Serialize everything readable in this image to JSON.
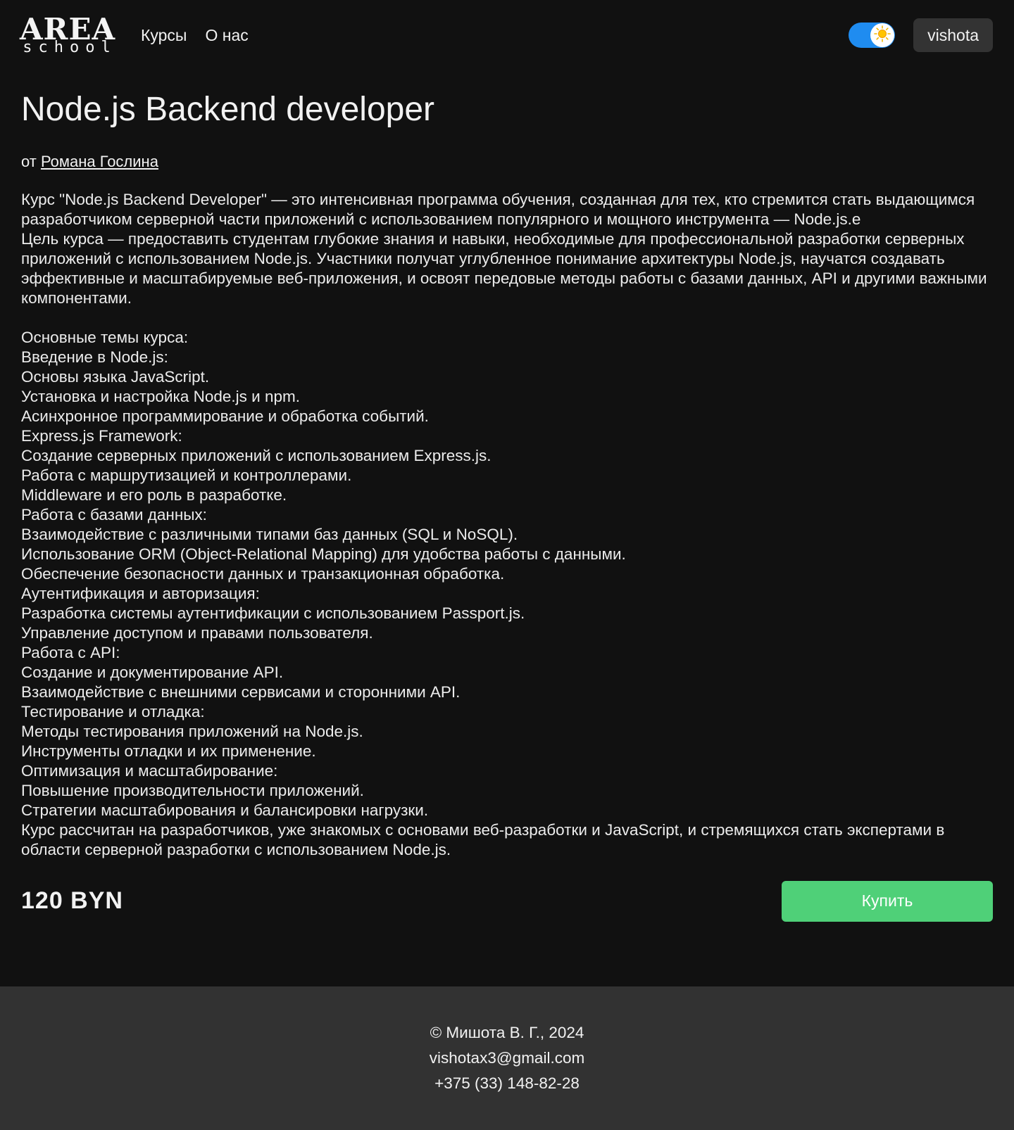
{
  "header": {
    "logo_main": "AREA",
    "logo_sub": "school",
    "nav": [
      {
        "label": "Курсы"
      },
      {
        "label": "О нас"
      }
    ],
    "theme_toggle_icon": "sun-icon",
    "user_label": "vishota"
  },
  "course": {
    "title": "Node.js Backend developer",
    "author_prefix": "от ",
    "author_name": "Романа Гослина",
    "description": "Курс \"Node.js Backend Developer\" — это интенсивная программа обучения, созданная для тех, кто стремится стать выдающимся разработчиком серверной части приложений с использованием популярного и мощного инструмента — Node.js.e\nЦель курса — предоставить студентам глубокие знания и навыки, необходимые для профессиональной разработки серверных приложений с использованием Node.js. Участники получат углубленное понимание архитектуры Node.js, научатся создавать эффективные и масштабируемые веб-приложения, и освоят передовые методы работы с базами данных, API и другими важными компонентами.\n\nОсновные темы курса:\nВведение в Node.js:\nОсновы языка JavaScript.\nУстановка и настройка Node.js и npm.\nАсинхронное программирование и обработка событий.\nExpress.js Framework:\nСоздание серверных приложений с использованием Express.js.\nРабота с маршрутизацией и контроллерами.\nMiddleware и его роль в разработке.\nРабота с базами данных:\nВзаимодействие с различными типами баз данных (SQL и NoSQL).\nИспользование ORM (Object-Relational Mapping) для удобства работы с данными.\nОбеспечение безопасности данных и транзакционная обработка.\nАутентификация и авторизация:\nРазработка системы аутентификации с использованием Passport.js.\nУправление доступом и правами пользователя.\nРабота с API:\nСоздание и документирование API.\nВзаимодействие с внешними сервисами и сторонними API.\nТестирование и отладка:\nМетоды тестирования приложений на Node.js.\nИнструменты отладки и их применение.\nОптимизация и масштабирование:\nПовышение производительности приложений.\nСтратегии масштабирования и балансировки нагрузки.\nКурс рассчитан на разработчиков, уже знакомых с основами веб-разработки и JavaScript, и стремящихся стать экспертами в области серверной разработки с использованием Node.js.",
    "price": "120 BYN",
    "buy_label": "Купить"
  },
  "footer": {
    "copyright": "© Мишота В. Г., 2024",
    "email": "vishotax3@gmail.com",
    "phone": "+375 (33) 148-82-28"
  },
  "colors": {
    "background": "#111111",
    "footer_background": "#323232",
    "toggle_accent": "#1f8cf0",
    "buy_button": "#4fd078",
    "user_button": "#333333"
  }
}
